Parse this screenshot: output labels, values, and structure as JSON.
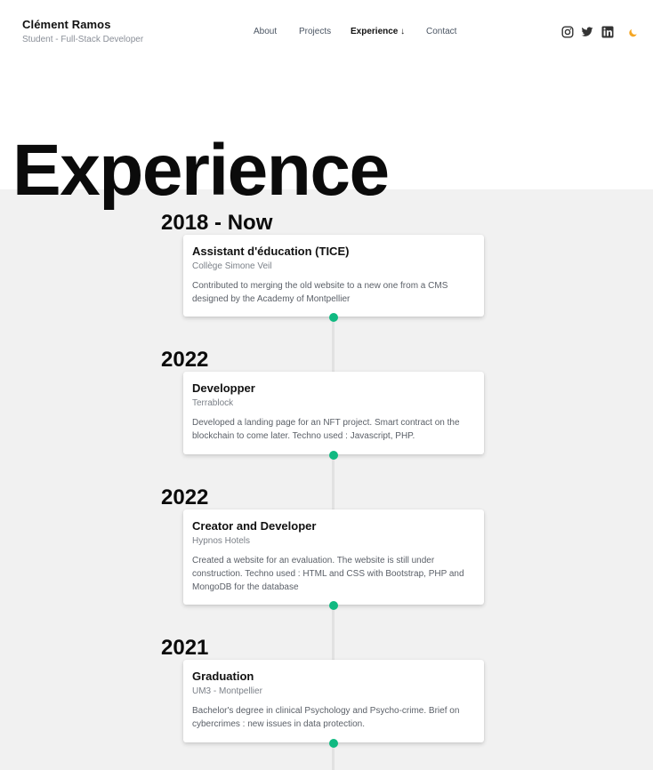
{
  "header": {
    "name": "Clément Ramos",
    "subtitle": "Student - Full-Stack Developer",
    "nav": {
      "about": "About",
      "projects": "Projects",
      "experience": "Experience ↓",
      "contact": "Contact"
    },
    "social": [
      "instagram-icon",
      "twitter-icon",
      "linkedin-icon",
      "moon-icon"
    ],
    "accent_color": "#f5a623"
  },
  "hero": {
    "title": "Experience"
  },
  "timeline": {
    "dot_color": "#10b981",
    "items": [
      {
        "year": "2018 - Now",
        "title": "Assistant d'éducation (TICE)",
        "org": "Collège Simone Veil",
        "desc": "Contributed to merging the old website to a new one from a CMS designed by the Academy of Montpellier"
      },
      {
        "year": "2022",
        "title": "Developper",
        "org": "Terrablock",
        "desc": "Developed a landing page for an NFT project. Smart contract on the blockchain to come later. Techno used : Javascript, PHP."
      },
      {
        "year": "2022",
        "title": "Creator and Developer",
        "org": "Hypnos Hotels",
        "desc": "Created a website for an evaluation. The website is still under construction. Techno used : HTML and CSS with Bootstrap, PHP and MongoDB for the database"
      },
      {
        "year": "2021",
        "title": "Graduation",
        "org": "UM3 - Montpellier",
        "desc": "Bachelor's degree in clinical Psychology and Psycho-crime. Brief on cybercrimes : new issues in data protection."
      }
    ]
  }
}
